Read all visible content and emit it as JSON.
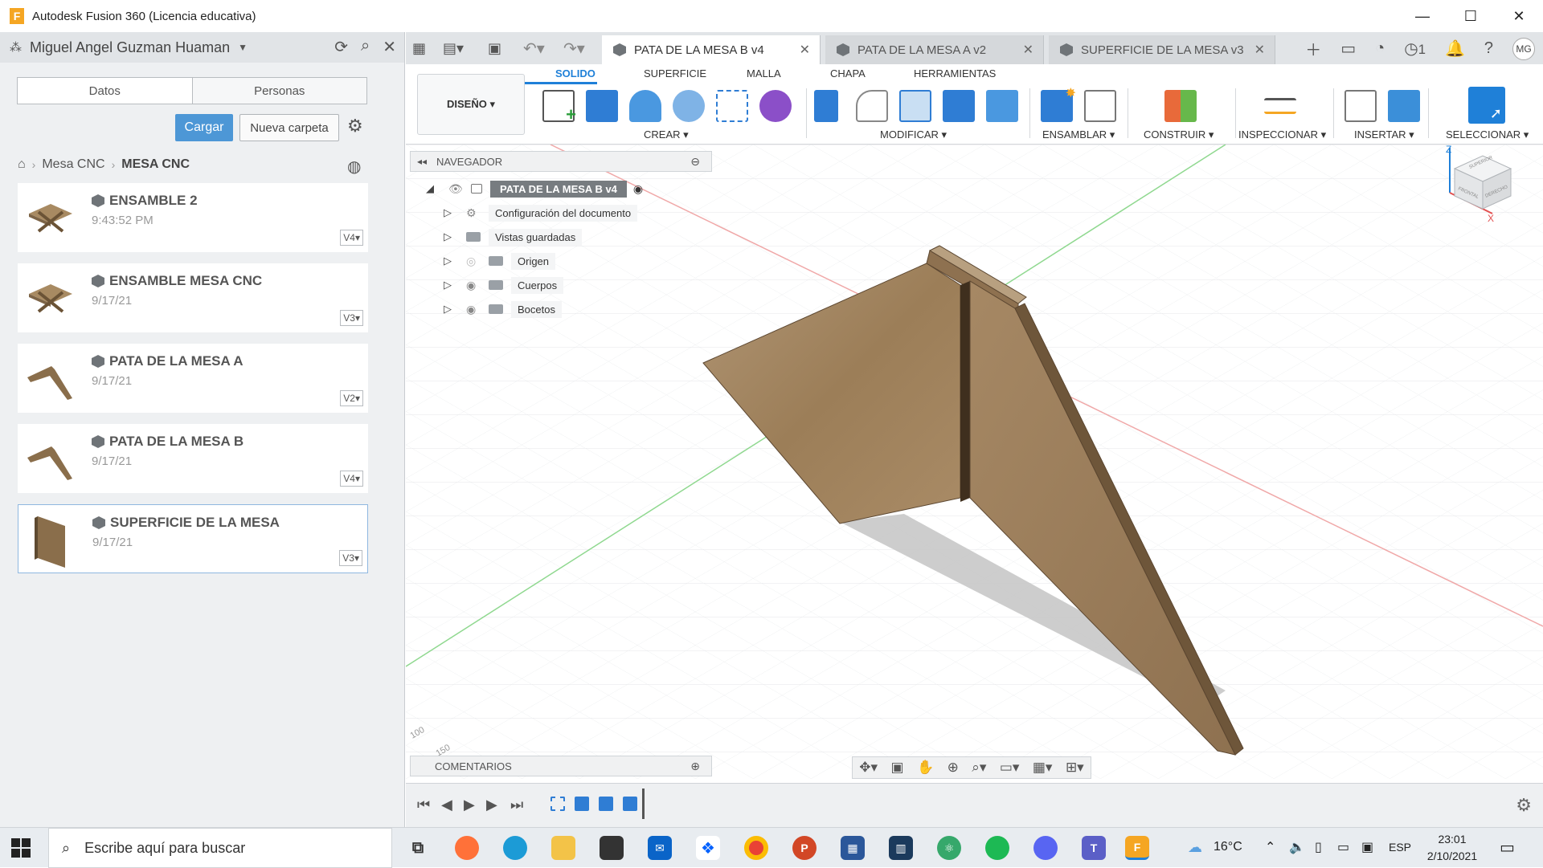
{
  "window": {
    "title": "Autodesk Fusion 360 (Licencia educativa)",
    "minimize": "—",
    "maximize": "☐",
    "close": "✕"
  },
  "data_panel": {
    "user_name": "Miguel Angel Guzman Huaman",
    "tabs": [
      "Datos",
      "Personas"
    ],
    "upload_label": "Cargar",
    "new_folder_label": "Nueva carpeta",
    "breadcrumb": [
      "Mesa CNC",
      "MESA CNC"
    ],
    "files": [
      {
        "name": "ENSAMBLE 2",
        "date": "9:43:52 PM",
        "version": "V4"
      },
      {
        "name": "ENSAMBLE MESA CNC",
        "date": "9/17/21",
        "version": "V3"
      },
      {
        "name": "PATA DE LA MESA A",
        "date": "9/17/21",
        "version": "V2"
      },
      {
        "name": "PATA DE LA MESA B",
        "date": "9/17/21",
        "version": "V4"
      },
      {
        "name": "SUPERFICIE DE LA MESA",
        "date": "9/17/21",
        "version": "V3"
      }
    ]
  },
  "doc_tabs": [
    {
      "label": "PATA DE LA MESA B v4",
      "active": true
    },
    {
      "label": "PATA DE LA MESA A v2",
      "active": false
    },
    {
      "label": "SUPERFICIE DE LA MESA v3",
      "active": false
    }
  ],
  "header_right": {
    "jobs_count": "1",
    "user_initials": "MG"
  },
  "toolbar": {
    "workspace": "DISEÑO ▾",
    "tabs": [
      "SOLIDO",
      "SUPERFICIE",
      "MALLA",
      "CHAPA",
      "HERRAMIENTAS"
    ],
    "groups": [
      "CREAR ▾",
      "MODIFICAR ▾",
      "ENSAMBLAR ▾",
      "CONSTRUIR ▾",
      "INSPECCIONAR ▾",
      "INSERTAR ▾",
      "SELECCIONAR ▾"
    ]
  },
  "browser": {
    "title": "NAVEGADOR",
    "root": "PATA DE LA MESA  B v4",
    "items": [
      "Configuración del documento",
      "Vistas guardadas",
      "Origen",
      "Cuerpos",
      "Bocetos"
    ]
  },
  "comments_label": "COMENTARIOS",
  "grid_labels": [
    "100",
    "150"
  ],
  "viewcube": {
    "axis_z": "Z",
    "axis_x": "X",
    "top": "SUPERIOR",
    "front": "FRONTAL",
    "right": "DERECHO"
  },
  "taskbar": {
    "search_placeholder": "Escribe aquí para buscar",
    "temperature": "16°C",
    "language": "ESP",
    "time": "23:01",
    "date": "2/10/2021"
  },
  "colors": {
    "accent": "#1f80d8",
    "upload_button": "#4d97d6",
    "wood": "#a88a62"
  }
}
